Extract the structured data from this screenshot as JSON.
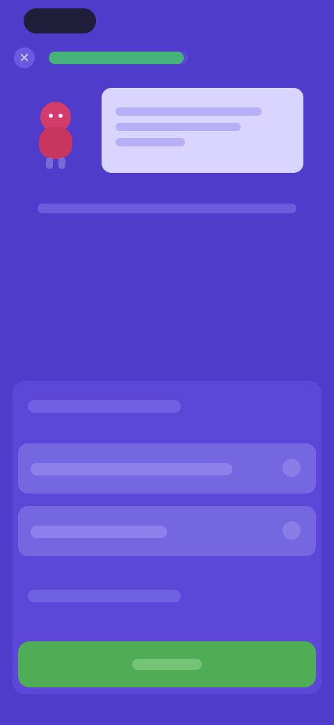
{
  "header": {
    "close_icon": "close-icon",
    "progress_fraction": 0.97,
    "progress_color": "#47b27a"
  },
  "tutor": {
    "avatar_icon": "avatar-character-icon",
    "speech": ""
  },
  "instruction": "",
  "question": {
    "prompt": "",
    "options": [
      {
        "label": ""
      },
      {
        "label": ""
      }
    ],
    "hint": ""
  },
  "cta": {
    "label": ""
  },
  "colors": {
    "background": "#4f3ccb",
    "sheet": "#5c47d8",
    "option": "#7567e0",
    "cta": "#4fad55",
    "speech_bubble": "#d9d5ff"
  }
}
